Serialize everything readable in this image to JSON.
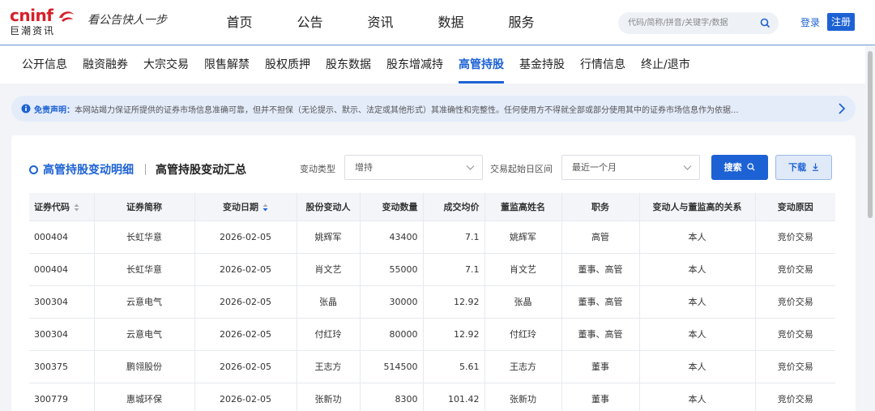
{
  "header": {
    "logo_top": "cninf",
    "logo_bottom": "巨潮资讯",
    "slogan": "看公告快人一步",
    "nav": [
      "首页",
      "公告",
      "资讯",
      "数据",
      "服务"
    ],
    "search_placeholder": "代码/简称/拼音/关键字/数据",
    "login": "登录",
    "register": "注册"
  },
  "subnav": {
    "items": [
      "公开信息",
      "融资融券",
      "大宗交易",
      "限售解禁",
      "股权质押",
      "股东数据",
      "股东增减持",
      "高管持股",
      "基金持股",
      "行情信息",
      "终止/退市"
    ],
    "active_index": 7
  },
  "notice": {
    "label": "免责声明：",
    "text": "本网站竭力保证所提供的证券市场信息准确可靠，但并不担保（无论提示、默示、法定或其他形式）其准确性和完整性。任何使用方不得就全部或部分使用其中的证券市场信息作为依据..."
  },
  "panel": {
    "tab_active": "高管持股变动明细",
    "tab_other": "高管持股变动汇总",
    "filter1_label": "变动类型",
    "filter1_value": "增持",
    "filter2_label": "交易起始日区间",
    "filter2_value": "最近一个月",
    "search_button": "搜索",
    "download_button": "下载"
  },
  "table": {
    "headers": [
      "证券代码",
      "证券简称",
      "变动日期",
      "股份变动人",
      "变动数量",
      "成交均价",
      "董监高姓名",
      "职务",
      "变动人与董监高的关系",
      "变动原因"
    ],
    "rows": [
      [
        "000404",
        "长虹华意",
        "2026-02-05",
        "姚辉军",
        "43400",
        "7.1",
        "姚辉军",
        "高管",
        "本人",
        "竞价交易"
      ],
      [
        "000404",
        "长虹华意",
        "2026-02-05",
        "肖文艺",
        "55000",
        "7.1",
        "肖文艺",
        "董事、高管",
        "本人",
        "竞价交易"
      ],
      [
        "300304",
        "云意电气",
        "2026-02-05",
        "张晶",
        "30000",
        "12.92",
        "张晶",
        "董事、高管",
        "本人",
        "竞价交易"
      ],
      [
        "300304",
        "云意电气",
        "2026-02-05",
        "付红玲",
        "80000",
        "12.92",
        "付红玲",
        "董事、高管",
        "本人",
        "竞价交易"
      ],
      [
        "300375",
        "鹏翎股份",
        "2026-02-05",
        "王志方",
        "514500",
        "5.61",
        "王志方",
        "董事",
        "本人",
        "竞价交易"
      ],
      [
        "300779",
        "惠城环保",
        "2026-02-05",
        "张新功",
        "8300",
        "101.42",
        "张新功",
        "董事",
        "本人",
        "竞价交易"
      ]
    ]
  },
  "colors": {
    "brand_red": "#d6202a",
    "accent_blue": "#1d62d4"
  }
}
